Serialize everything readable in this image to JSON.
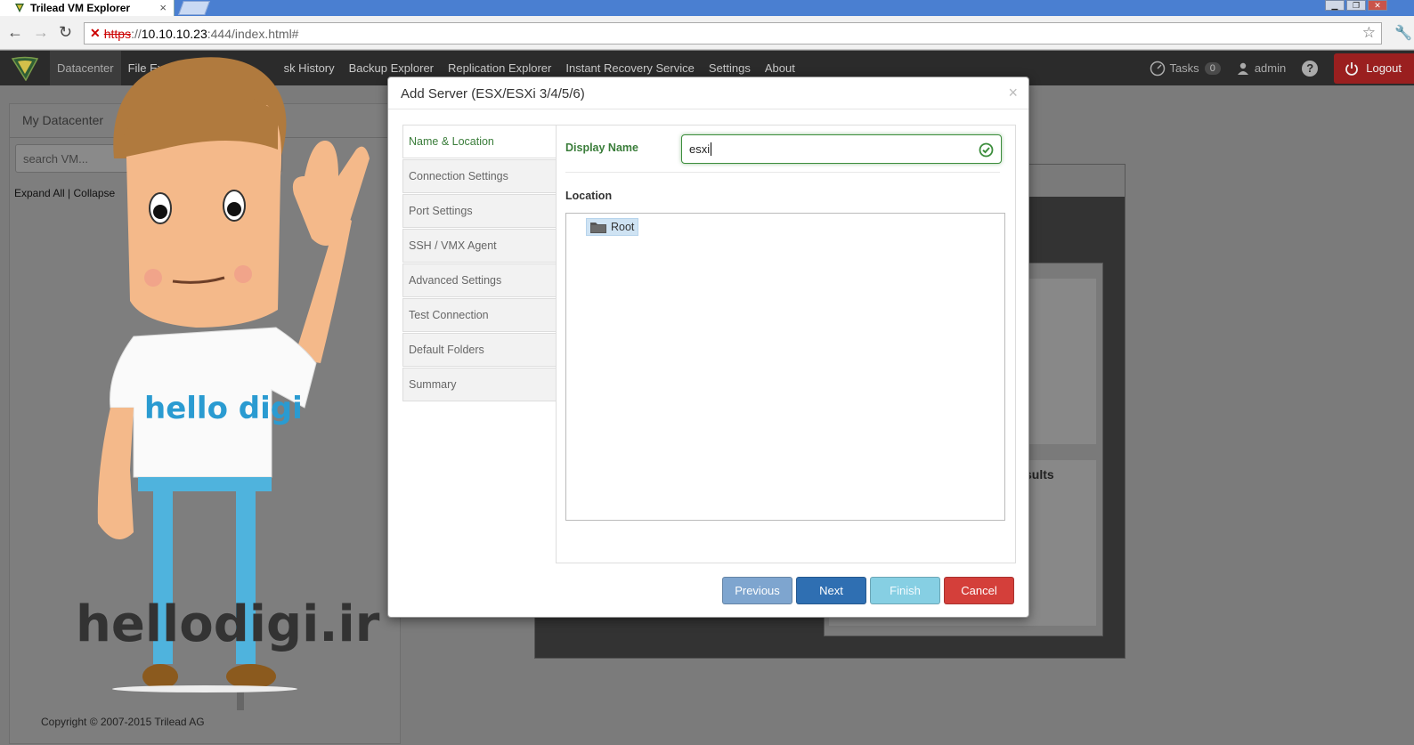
{
  "browser": {
    "tab_title": "Trilead VM Explorer",
    "tab_close": "×",
    "url_scheme": "https",
    "url_host": "10.10.10.23",
    "url_rest": ":444/index.html#"
  },
  "appnav": {
    "items": [
      {
        "label": "Datacenter",
        "active": true
      },
      {
        "label": "File Explorer"
      },
      {
        "label": "sk History"
      },
      {
        "label": "Backup Explorer"
      },
      {
        "label": "Replication Explorer"
      },
      {
        "label": "Instant Recovery Service"
      },
      {
        "label": "Settings"
      },
      {
        "label": "About"
      }
    ],
    "tasks_label": "Tasks",
    "tasks_count": "0",
    "user": "admin",
    "help": "?",
    "logout": "Logout"
  },
  "page": {
    "panel_title": "My Datacenter",
    "search_placeholder": "search VM...",
    "expand_collapse": "Expand All | Collapse",
    "bg_results_fragment": "sults",
    "copyright": "Copyright © 2007-2015 Trilead AG"
  },
  "watermark": {
    "shirt_text": "hello digi",
    "site_text": "hellodigi.ir"
  },
  "modal": {
    "title": "Add Server (ESX/ESXi 3/4/5/6)",
    "close": "×",
    "steps": [
      {
        "label": "Name & Location",
        "active": true
      },
      {
        "label": "Connection Settings"
      },
      {
        "label": "Port Settings"
      },
      {
        "label": "SSH / VMX Agent"
      },
      {
        "label": "Advanced Settings"
      },
      {
        "label": "Test Connection"
      },
      {
        "label": "Default Folders"
      },
      {
        "label": "Summary"
      }
    ],
    "display_name_label": "Display Name",
    "display_name_value": "esxi",
    "location_label": "Location",
    "tree_root": "Root",
    "buttons": {
      "previous": "Previous",
      "next": "Next",
      "finish": "Finish",
      "cancel": "Cancel"
    }
  },
  "colors": {
    "active_green": "#3a7d3a",
    "next_blue": "#2f6fb2",
    "cancel_red": "#d43f3a",
    "logout_red": "#9a1f1f"
  }
}
